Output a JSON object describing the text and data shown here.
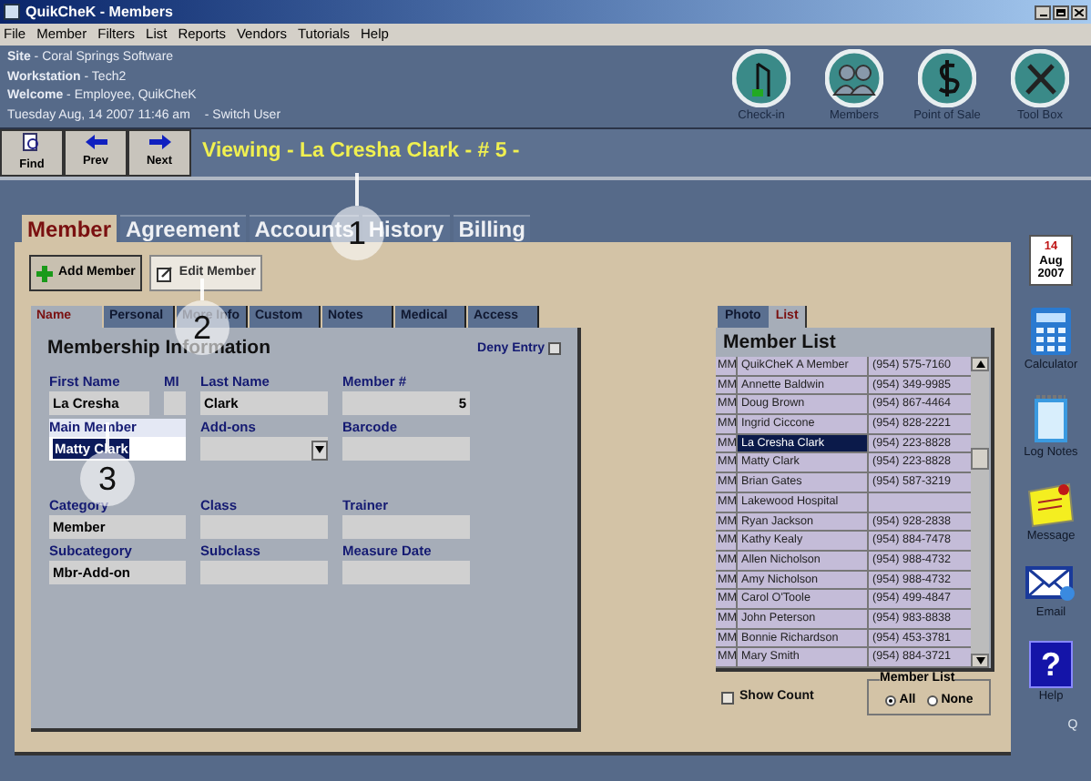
{
  "window": {
    "title": "QuikCheK - Members"
  },
  "menu": [
    "File",
    "Member",
    "Filters",
    "List",
    "Reports",
    "Vendors",
    "Tutorials",
    "Help"
  ],
  "session": {
    "lines": [
      "**Site** - Coral Springs Software",
      "**Workstation** - Tech2",
      "**Welcome** - Employee, QuikCheK"
    ],
    "datetime": "Tuesday Aug, 14 2007 11:46 am",
    "switch_user": "- Switch User"
  },
  "launchers": [
    {
      "label": "Check-in",
      "kind": "checkin"
    },
    {
      "label": "Members",
      "kind": "members"
    },
    {
      "label": "Point of Sale",
      "kind": "pos"
    },
    {
      "label": "Tool Box",
      "kind": "toolbox"
    }
  ],
  "nav_buttons": [
    {
      "label": "Find",
      "kind": "find"
    },
    {
      "label": "Prev",
      "kind": "prev"
    },
    {
      "label": "Next",
      "kind": "next"
    }
  ],
  "viewing": "Viewing - La Cresha Clark - # 5 -",
  "tabs": [
    {
      "label": "Member",
      "selected": true
    },
    {
      "label": "Agreement",
      "selected": false
    },
    {
      "label": "Accounts",
      "selected": false
    },
    {
      "label": "History",
      "selected": false
    },
    {
      "label": "Billing",
      "selected": false
    }
  ],
  "actions": [
    {
      "label": "Add Member",
      "kind": "add"
    },
    {
      "label": "Edit Member",
      "kind": "edit"
    }
  ],
  "subtabs": [
    {
      "label": "Name",
      "selected": true
    },
    {
      "label": "Personal",
      "selected": false
    },
    {
      "label": "More Info",
      "selected": false
    },
    {
      "label": "Custom",
      "selected": false
    },
    {
      "label": "Notes",
      "selected": false
    },
    {
      "label": "Medical",
      "selected": false
    },
    {
      "label": "Access",
      "selected": false
    }
  ],
  "form": {
    "title": "Membership Information",
    "deny_entry": {
      "label": "Deny Entry",
      "checked": false
    },
    "name_fields": [
      {
        "label": "First Name",
        "value": "La Cresha",
        "kind": "text"
      },
      {
        "label": "MI",
        "kind": "small"
      },
      {
        "label": "Last Name",
        "value": "Clark",
        "kind": "text"
      },
      {
        "label": "Member #",
        "value": "5",
        "kind": "number"
      }
    ],
    "rows": [
      [
        {
          "label": "Main Member",
          "value": "Matty Clark",
          "kind": "highlighted"
        },
        {
          "label": "Add-ons",
          "kind": "dropdown"
        },
        {
          "label": "Barcode",
          "kind": "text"
        }
      ],
      [
        {
          "label": "Category",
          "value": "Member",
          "kind": "text"
        },
        {
          "label": "Class",
          "kind": "text"
        },
        {
          "label": "Trainer",
          "kind": "text"
        }
      ],
      [
        {
          "label": "Subcategory",
          "value": "Mbr-Add-on",
          "kind": "text"
        },
        {
          "label": "Subclass",
          "kind": "text"
        },
        {
          "label": "Measure Date",
          "kind": "text"
        }
      ]
    ]
  },
  "member_list": {
    "tabs": [
      {
        "label": "Photo",
        "selected": false
      },
      {
        "label": "List",
        "selected": true
      }
    ],
    "title": "Member List",
    "rows": [
      {
        "type": "MM",
        "name": "QuikCheK A Member",
        "phone": "(954) 575-7160",
        "selected": false
      },
      {
        "type": "MM",
        "name": "Annette Baldwin",
        "phone": "(954) 349-9985",
        "selected": false
      },
      {
        "type": "MM",
        "name": "Doug Brown",
        "phone": "(954) 867-4464",
        "selected": false
      },
      {
        "type": "MM",
        "name": "Ingrid Ciccone",
        "phone": "(954) 828-2221",
        "selected": false
      },
      {
        "type": "MM",
        "name": "La Cresha Clark",
        "phone": "(954) 223-8828",
        "selected": true
      },
      {
        "type": "MM",
        "name": "Matty Clark",
        "phone": "(954) 223-8828",
        "selected": false
      },
      {
        "type": "MM",
        "name": "Brian Gates",
        "phone": "(954) 587-3219",
        "selected": false
      },
      {
        "type": "MM",
        "name": "Lakewood Hospital",
        "selected": false
      },
      {
        "type": "MM",
        "name": "Ryan Jackson",
        "phone": "(954) 928-2838",
        "selected": false
      },
      {
        "type": "MM",
        "name": "Kathy Kealy",
        "phone": "(954) 884-7478",
        "selected": false
      },
      {
        "type": "MM",
        "name": "Allen Nicholson",
        "phone": "(954) 988-4732",
        "selected": false
      },
      {
        "type": "MM",
        "name": "Amy Nicholson",
        "phone": "(954) 988-4732",
        "selected": false
      },
      {
        "type": "MM",
        "name": "Carol O'Toole",
        "phone": "(954) 499-4847",
        "selected": false
      },
      {
        "type": "MM",
        "name": "John Peterson",
        "phone": "(954) 983-8838",
        "selected": false
      },
      {
        "type": "MM",
        "name": "Bonnie Richardson",
        "phone": "(954) 453-3781",
        "selected": false
      },
      {
        "type": "MM",
        "name": "Mary Smith",
        "phone": "(954) 884-3721",
        "selected": false
      }
    ],
    "show_count": {
      "label": "Show Count",
      "checked": false
    },
    "filter": {
      "title": "Member List",
      "options": [
        {
          "label": "All",
          "selected": true
        },
        {
          "label": "None",
          "selected": false
        }
      ]
    }
  },
  "sidebar": {
    "date": {
      "day": "14",
      "month": "Aug",
      "year": "2007"
    },
    "tools": [
      {
        "label": "Calculator",
        "kind": "calculator"
      },
      {
        "label": "Log Notes",
        "kind": "notes"
      },
      {
        "label": "Message",
        "kind": "message"
      },
      {
        "label": "Email",
        "kind": "email"
      },
      {
        "label": "Help",
        "kind": "help",
        "glyph": "?"
      }
    ],
    "footer": "Q"
  },
  "callouts": [
    "1",
    "2",
    "3"
  ]
}
